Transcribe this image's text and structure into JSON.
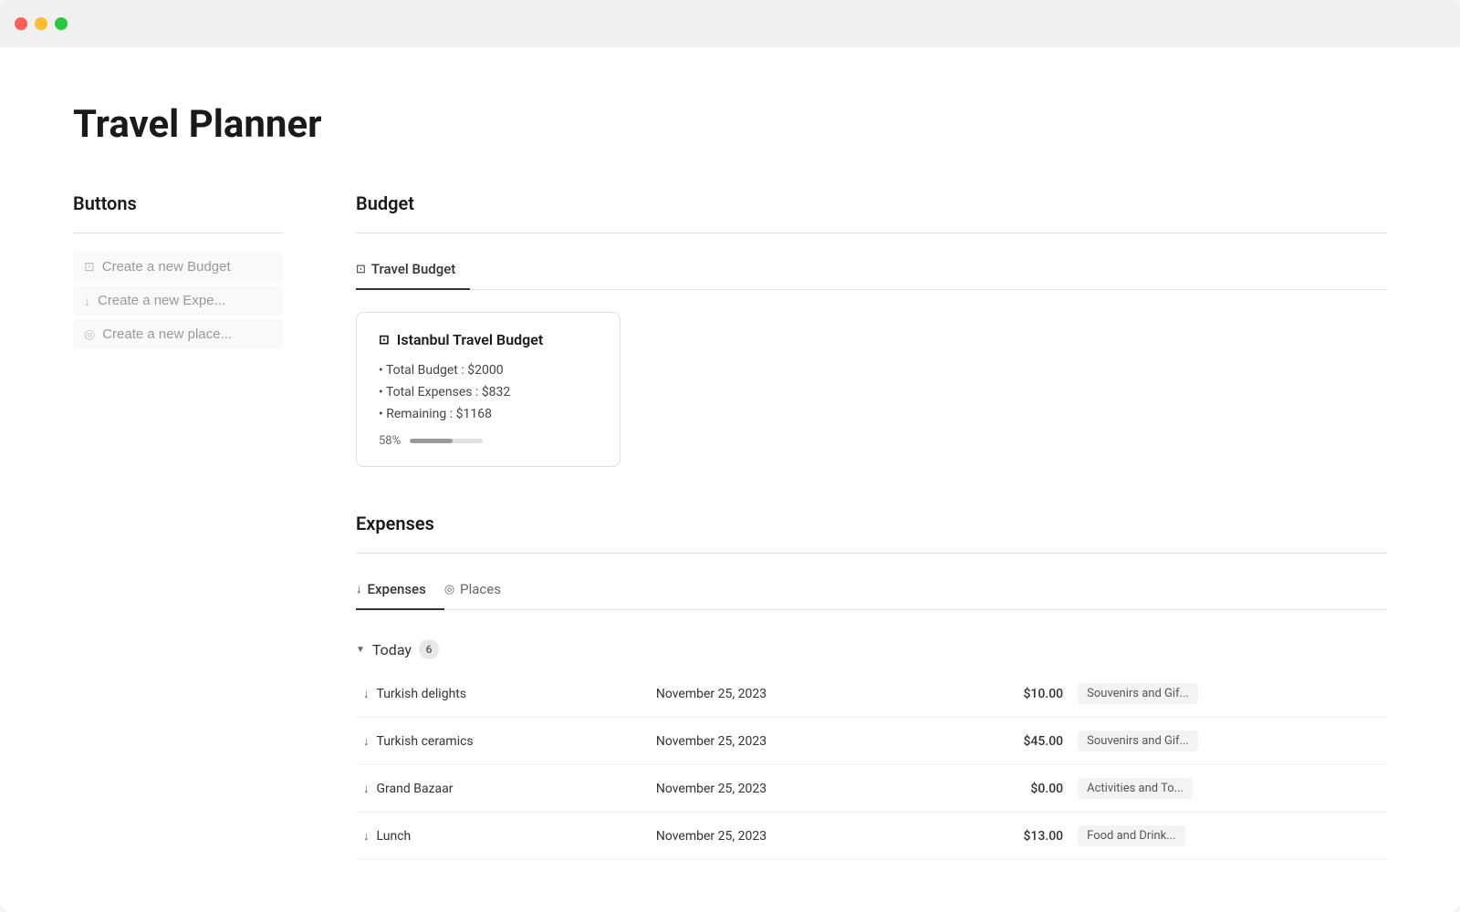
{
  "window": {
    "title": "Travel Planner"
  },
  "page": {
    "title": "Travel Planner"
  },
  "left_panel": {
    "heading": "Buttons",
    "buttons": [
      {
        "id": "create-budget",
        "icon": "📷",
        "label": "Create a new Budget"
      },
      {
        "id": "create-expense",
        "icon": "⬇",
        "label": "Create a new Expe..."
      },
      {
        "id": "create-place",
        "icon": "📍",
        "label": "Create a new place..."
      }
    ]
  },
  "budget_section": {
    "heading": "Budget",
    "tabs": [
      {
        "id": "travel-budget",
        "icon": "📷",
        "label": "Travel Budget",
        "active": true
      }
    ],
    "card": {
      "icon": "📷",
      "title": "Istanbul Travel Budget",
      "total_budget_label": "Total Budget",
      "total_budget_value": "$2000",
      "total_expenses_label": "Total Expenses",
      "total_expenses_value": "$832",
      "remaining_label": "Remaining",
      "remaining_value": "$1168",
      "progress_percent": 58,
      "progress_percent_label": "58%",
      "progress_bar_width": "58"
    }
  },
  "expenses_section": {
    "heading": "Expenses",
    "tabs": [
      {
        "id": "expenses",
        "icon": "⬇",
        "label": "Expenses",
        "active": true
      },
      {
        "id": "places",
        "icon": "📍",
        "label": "Places",
        "active": false
      }
    ],
    "today_group": {
      "label": "Today",
      "count": "6"
    },
    "rows": [
      {
        "name": "Turkish delights",
        "date": "November 25, 2023",
        "amount": "$10.00",
        "category": "Souvenirs and Gif..."
      },
      {
        "name": "Turkish ceramics",
        "date": "November 25, 2023",
        "amount": "$45.00",
        "category": "Souvenirs and Gif..."
      },
      {
        "name": "Grand Bazaar",
        "date": "November 25, 2023",
        "amount": "$0.00",
        "category": "Activities and To..."
      },
      {
        "name": "Lunch",
        "date": "November 25, 2023",
        "amount": "$13.00",
        "category": "Food and Drink..."
      }
    ]
  }
}
